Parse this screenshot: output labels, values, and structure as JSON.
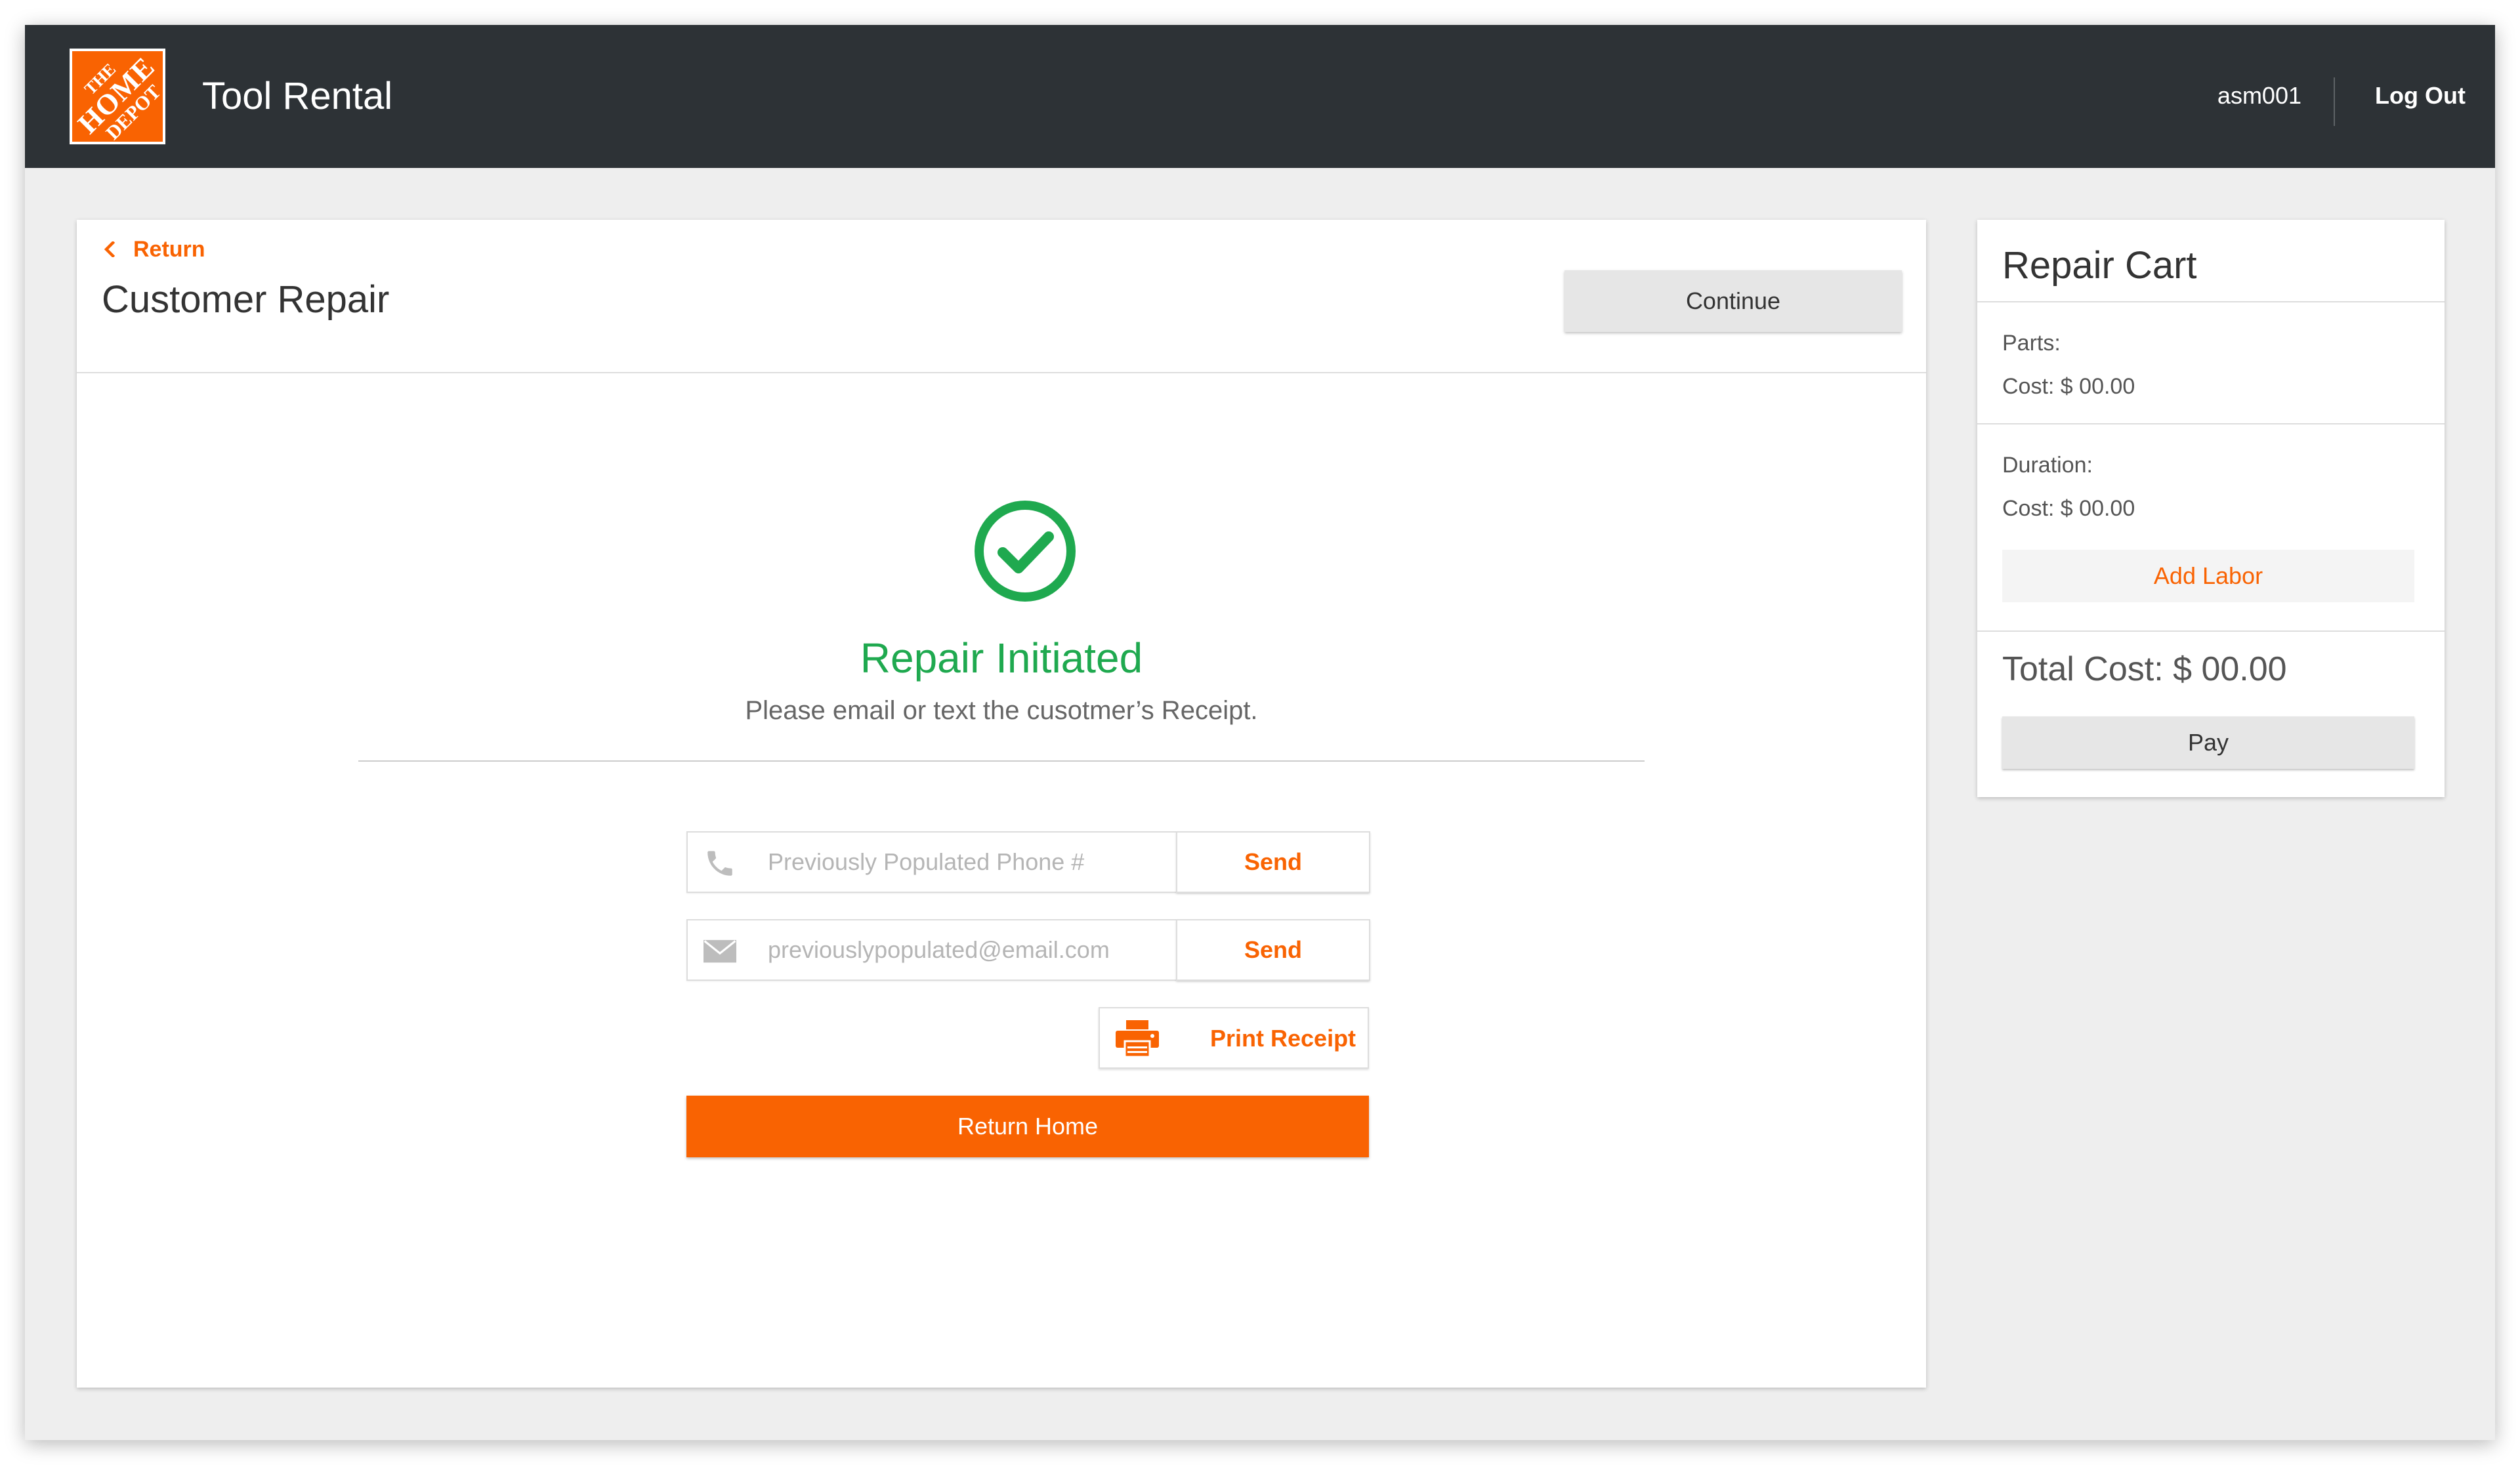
{
  "header": {
    "logo_text": [
      "THE",
      "HOME",
      "DEPOT"
    ],
    "app_title": "Tool Rental",
    "user": "asm001",
    "logout_label": "Log Out"
  },
  "main": {
    "return_label": "Return",
    "page_title": "Customer Repair",
    "continue_label": "Continue",
    "status_title": "Repair Initiated",
    "status_subtitle": "Please email or text the cusotmer’s Receipt.",
    "phone": {
      "value": "",
      "placeholder": "Previously Populated Phone #",
      "send_label": "Send"
    },
    "email": {
      "value": "",
      "placeholder": "previouslypopulated@email.com",
      "send_label": "Send"
    },
    "print_label": "Print Receipt",
    "return_home_label": "Return Home"
  },
  "cart": {
    "title": "Repair Cart",
    "parts_label": "Parts:",
    "parts_cost": "Cost: $ 00.00",
    "duration_label": "Duration:",
    "duration_cost": "Cost: $ 00.00",
    "add_labor_label": "Add Labor",
    "total_cost": "Total Cost: $ 00.00",
    "pay_label": "Pay"
  },
  "colors": {
    "brand_orange": "#f96302",
    "success_green": "#1fa94f",
    "header_bg": "#2d3236"
  },
  "icons": {
    "check": "check-circle-icon",
    "phone": "phone-icon",
    "email": "envelope-icon",
    "print": "printer-icon",
    "back": "chevron-left-icon"
  }
}
